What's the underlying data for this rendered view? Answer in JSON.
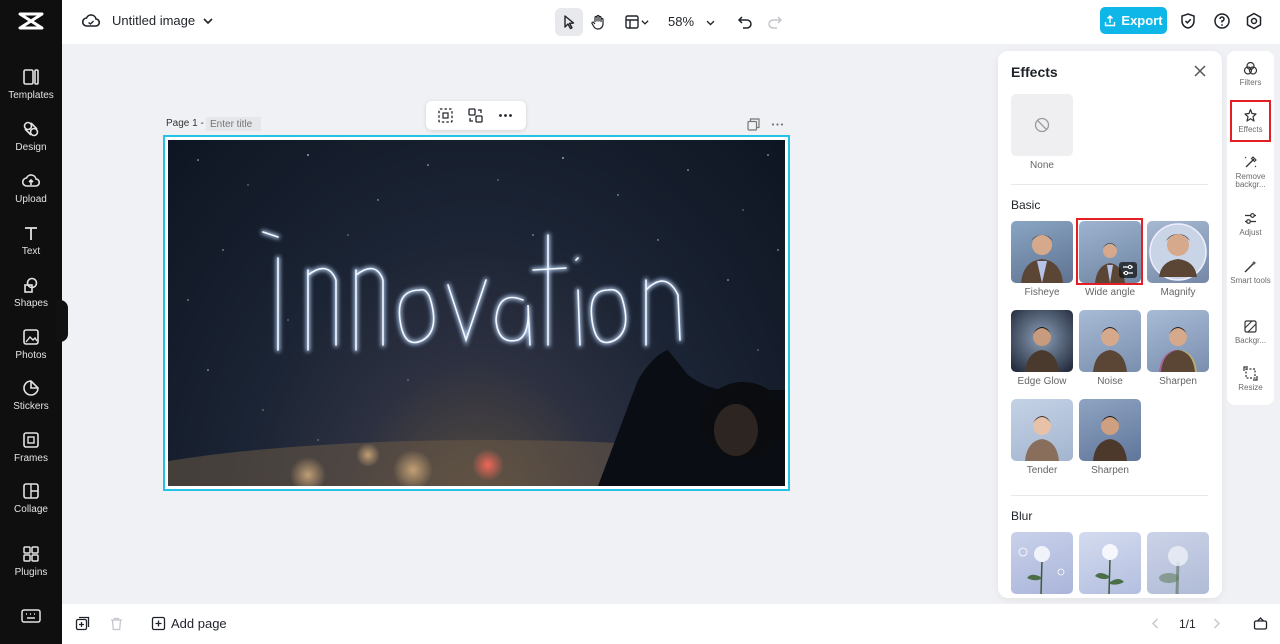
{
  "sidebar": {
    "items": [
      {
        "label": "Templates",
        "icon": "templates-icon"
      },
      {
        "label": "Design",
        "icon": "design-icon"
      },
      {
        "label": "Upload",
        "icon": "upload-icon"
      },
      {
        "label": "Text",
        "icon": "text-icon"
      },
      {
        "label": "Shapes",
        "icon": "shapes-icon"
      },
      {
        "label": "Photos",
        "icon": "photos-icon"
      },
      {
        "label": "Stickers",
        "icon": "stickers-icon"
      },
      {
        "label": "Frames",
        "icon": "frames-icon"
      },
      {
        "label": "Collage",
        "icon": "collage-icon"
      },
      {
        "label": "Plugins",
        "icon": "plugins-icon"
      }
    ]
  },
  "header": {
    "doc_title": "Untitled image",
    "zoom": "58%",
    "export_label": "Export"
  },
  "canvas": {
    "page_label": "Page 1 -",
    "title_placeholder": "Enter title",
    "image_text": "innovation"
  },
  "effects": {
    "title": "Effects",
    "none_label": "None",
    "basic_heading": "Basic",
    "basic_items": [
      "Fisheye",
      "Wide angle",
      "Magnify",
      "Edge Glow",
      "Noise",
      "Sharpen",
      "Tender",
      "Sharpen"
    ],
    "selected": "Wide angle",
    "blur_heading": "Blur"
  },
  "right_rail": {
    "items": [
      "Filters",
      "Effects",
      "Remove backgr...",
      "Adjust",
      "Smart tools",
      "Backgr...",
      "Resize"
    ],
    "selected": "Effects"
  },
  "footer": {
    "add_page_label": "Add page",
    "page_count": "1/1"
  },
  "colors": {
    "accent": "#0fb7e8",
    "selection": "#22c3e6",
    "highlight": "#e31e24",
    "sidebar_bg": "#0f0f10"
  }
}
